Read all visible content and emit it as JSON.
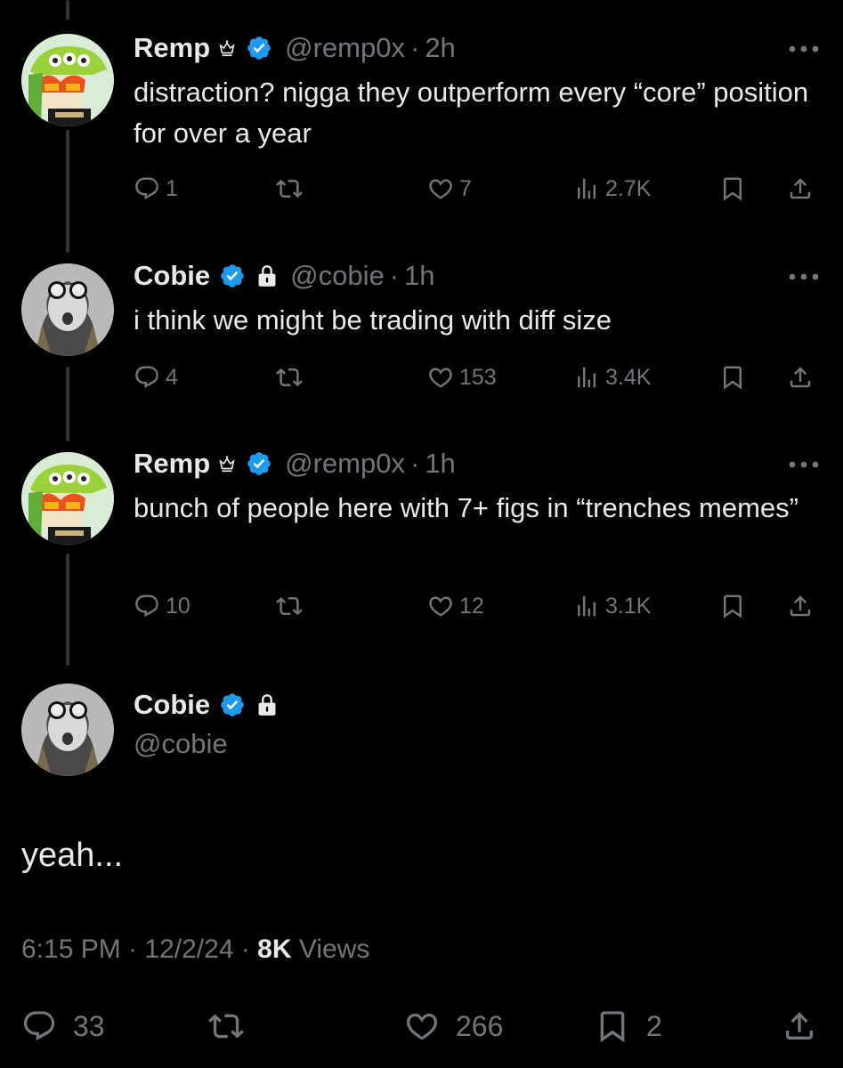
{
  "colors": {
    "background": "#000000",
    "text": "#e7e9ea",
    "muted": "#71767b",
    "verified": "#1d9bf0",
    "thread_line": "#333639"
  },
  "replies": [
    {
      "name": "Remp",
      "badge_icon": "crown-icon",
      "verified_icon": "verified-badge-icon",
      "handle": "@remp0x",
      "time": "2h",
      "text": "distraction? nigga they outperform every “core” position for over a year",
      "replies_count": "1",
      "reposts_count": "",
      "likes_count": "7",
      "views_count": "2.7K"
    },
    {
      "name": "Cobie",
      "badge_icon": "lock-icon",
      "verified_icon": "verified-badge-icon",
      "handle": "@cobie",
      "time": "1h",
      "text": "i think we might be trading with diff size",
      "replies_count": "4",
      "reposts_count": "",
      "likes_count": "153",
      "views_count": "3.4K"
    },
    {
      "name": "Remp",
      "badge_icon": "crown-icon",
      "verified_icon": "verified-badge-icon",
      "handle": "@remp0x",
      "time": "1h",
      "text": "bunch of people here with 7+ figs in “trenches memes”",
      "replies_count": "10",
      "reposts_count": "",
      "likes_count": "12",
      "views_count": "3.1K"
    }
  ],
  "main_tweet": {
    "name": "Cobie",
    "handle": "@cobie",
    "text": "yeah...",
    "time": "6:15 PM",
    "date": "12/2/24",
    "views_count": "8K",
    "views_label": "Views",
    "replies_count": "33",
    "likes_count": "266",
    "bookmarks_count": "2"
  }
}
